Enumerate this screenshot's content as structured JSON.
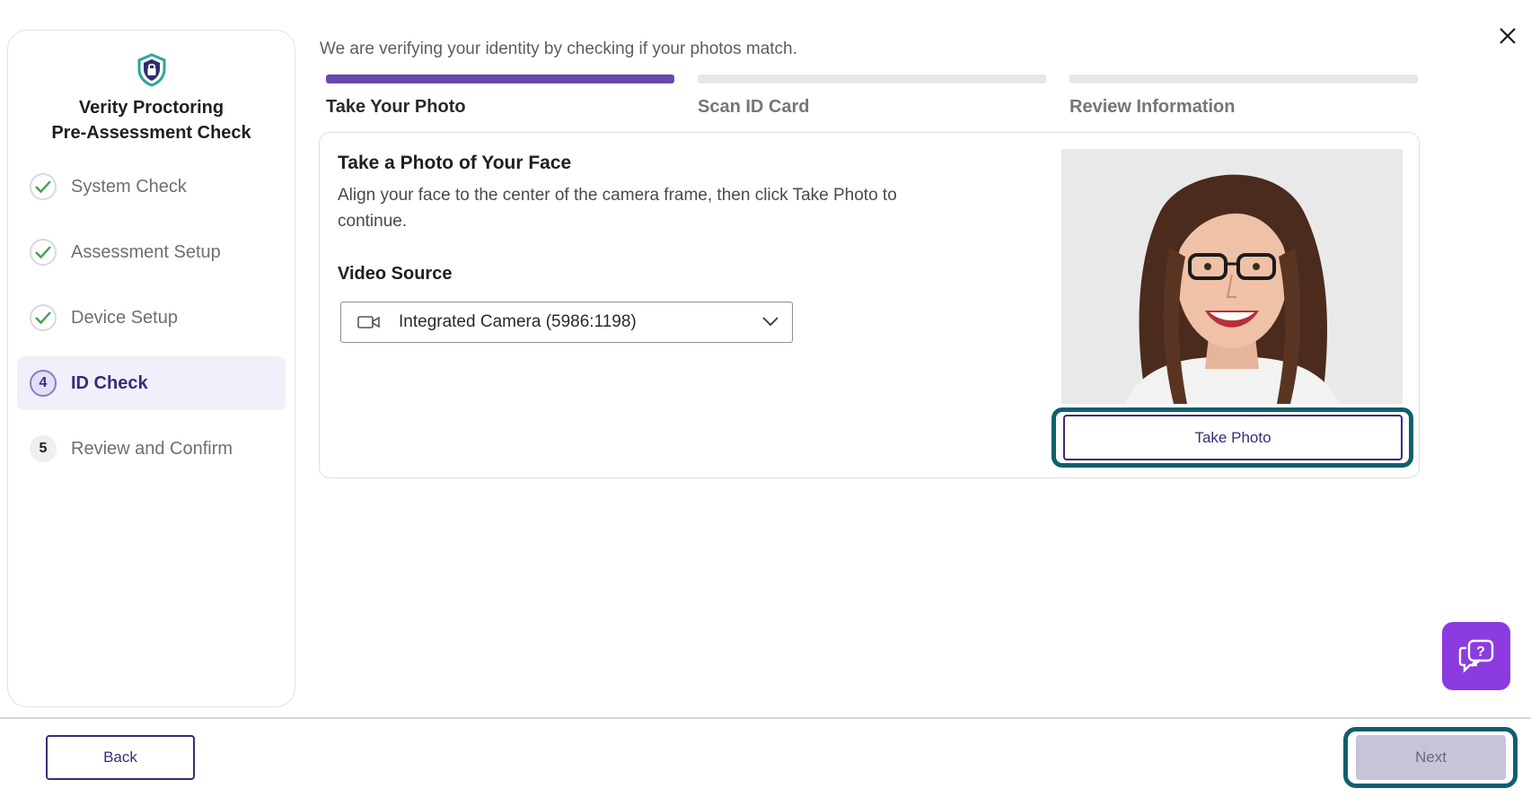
{
  "sidebar": {
    "brand_title_line1": "Verity Proctoring",
    "brand_title_line2": "Pre-Assessment Check",
    "steps": [
      {
        "marker": "",
        "label": "System Check",
        "state": "done"
      },
      {
        "marker": "",
        "label": "Assessment Setup",
        "state": "done"
      },
      {
        "marker": "",
        "label": "Device Setup",
        "state": "done"
      },
      {
        "marker": "4",
        "label": "ID Check",
        "state": "current"
      },
      {
        "marker": "5",
        "label": "Review and Confirm",
        "state": "todo"
      }
    ]
  },
  "header": {
    "intro": "We are verifying your identity by checking if your photos match."
  },
  "progress": {
    "tabs": [
      {
        "label": "Take Your Photo",
        "progress": 1.0
      },
      {
        "label": "Scan ID Card",
        "progress": 0.0
      },
      {
        "label": "Review Information",
        "progress": 0.0
      }
    ]
  },
  "card": {
    "title": "Take a Photo of Your Face",
    "description": "Align your face to the center of the camera frame, then click Take Photo to continue.",
    "video_source_label": "Video Source",
    "video_source_value": "Integrated Camera (5986:1198)",
    "take_photo_label": "Take Photo"
  },
  "footer": {
    "back_label": "Back",
    "next_label": "Next"
  },
  "colors": {
    "accent": "#3b2a7a",
    "progress_fill": "#6a47ad",
    "focus_ring": "#0f5f6e",
    "help_button": "#8b3be0",
    "check_green": "#43a047",
    "shield_teal": "#2aa79b"
  },
  "icons": {
    "brand": "shield-lock-icon",
    "done_step": "check-icon",
    "video": "video-camera-icon",
    "dropdown": "chevron-down-icon",
    "close": "close-icon",
    "help": "chat-question-icon"
  }
}
